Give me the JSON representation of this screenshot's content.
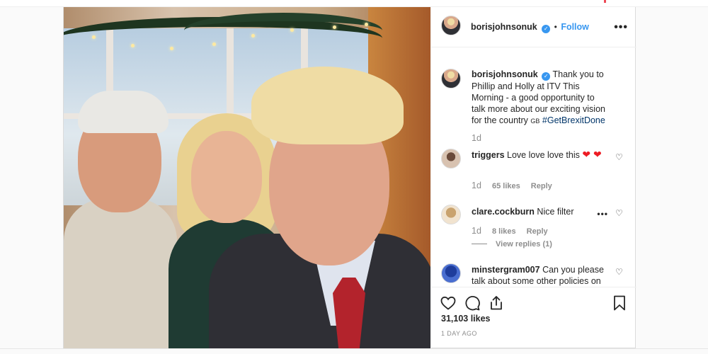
{
  "post": {
    "author": "borisjohnsonuk",
    "follow_label": "Follow",
    "more_label": "•••",
    "caption_user": "borisjohnsonuk",
    "caption_text": "Thank you to Phillip and Holly at ITV This Morning - a good opportunity to talk more about our exciting vision for the country",
    "caption_flag": "GB",
    "caption_hashtag": "#GetBrexitDone",
    "caption_age": "1d"
  },
  "comments": [
    {
      "user": "triggers",
      "text": "Love love love this",
      "emoji": "❤ ❤",
      "age": "1d",
      "likes": "65 likes",
      "reply": "Reply"
    },
    {
      "user": "clare.cockburn",
      "text": "Nice filter",
      "age": "1d",
      "likes": "8 likes",
      "reply": "Reply",
      "view_replies": "View replies (1)"
    },
    {
      "user": "minstergram007",
      "text": "Can you please talk about some other policies on"
    }
  ],
  "footer": {
    "likes": "31,103 likes",
    "posted": "1 DAY AGO"
  },
  "icons": {
    "like": "heart-icon",
    "comment": "comment-icon",
    "share": "share-icon",
    "save": "bookmark-icon",
    "verified": "verified-badge-icon",
    "comment_like": "heart-outline-icon"
  },
  "colors": {
    "link": "#3897f0",
    "hashtag": "#003569",
    "muted": "#8e8e8e",
    "emoji_heart": "#ed1c24"
  }
}
